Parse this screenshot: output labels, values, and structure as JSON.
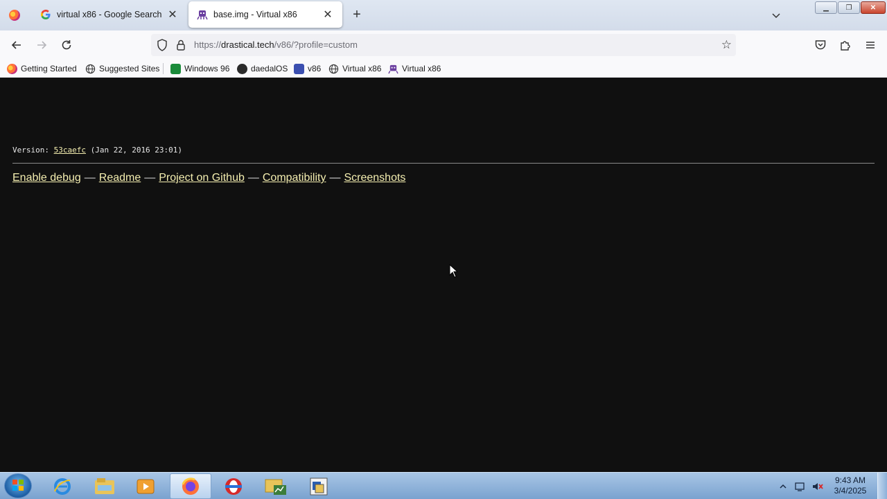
{
  "browser": {
    "tabs": [
      {
        "title": "virtual x86 - Google Search",
        "favicon": "google-icon",
        "active": false
      },
      {
        "title": "base.img - Virtual x86",
        "favicon": "v86-icon",
        "active": true
      }
    ],
    "url": {
      "scheme": "https://",
      "host": "drastical.tech",
      "path": "/v86/?profile=custom"
    },
    "bookmarks": [
      {
        "label": "Getting Started",
        "icon": "firefox-icon"
      },
      {
        "label": "Suggested Sites",
        "icon": "globe-icon"
      },
      {
        "label": "Windows 96",
        "icon": "windows96-icon"
      },
      {
        "label": "daedalOS",
        "icon": "daedalos-icon"
      },
      {
        "label": "v86",
        "icon": "v86-icon"
      },
      {
        "label": "Virtual x86",
        "icon": "globe-icon"
      },
      {
        "label": "Virtual x86",
        "icon": "v86-icon"
      }
    ]
  },
  "page": {
    "version_prefix": "Version: ",
    "version_hash": "53caefc",
    "version_date": " (Jan 22, 2016 23:01)",
    "links": [
      "Enable debug",
      "Readme",
      "Project on Github",
      "Compatibility",
      "Screenshots"
    ],
    "separator": "—"
  },
  "taskbar": {
    "items": [
      "internet-explorer-icon",
      "file-explorer-icon",
      "media-player-icon",
      "firefox-icon",
      "opera-icon",
      "network-folder-icon",
      "app-icon"
    ],
    "time": "9:43 AM",
    "date": "3/4/2025"
  },
  "colors": {
    "page_background": "#101010",
    "link": "#f4eeb0",
    "text": "#dcdcdc"
  }
}
